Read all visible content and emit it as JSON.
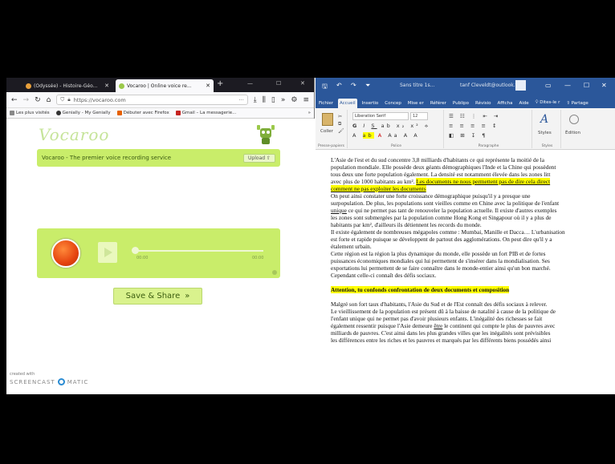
{
  "firefox": {
    "tabs": [
      {
        "title": "(Odyssée) - Histoire-Géo..."
      },
      {
        "title": "Vocaroo | Online voice re..."
      }
    ],
    "url": "https://vocaroo.com",
    "bookmarks": [
      "Les plus visités",
      "Genially - My Genially",
      "Débuter avec Firefox",
      "Gmail – La messagerie..."
    ]
  },
  "vocaroo": {
    "logo": "Vocaroo",
    "tagline": "Vocaroo - The premier voice recording service",
    "upload_label": "Upload ⇧",
    "time_start": "00:00",
    "time_end": "00:00",
    "save_share_label": "Save & Share",
    "save_share_arrow": "»"
  },
  "screencast": {
    "small": "created with",
    "brand": "SCREENCAST",
    "brand_suffix": "MATIC"
  },
  "word": {
    "filename": "Sans titre 1s...",
    "user": "tanf Cleveldt@outlook.fr",
    "menu": [
      "Fichier",
      "Accueil",
      "Insertio",
      "Concep",
      "Mise er",
      "Référer",
      "Publipo",
      "Révisio",
      "Afficha",
      "Aide",
      "Dites-le r",
      "Partage"
    ],
    "ribbon": {
      "paste": "Coller",
      "font_name": "Liberation Serif",
      "font_size": "12",
      "styles": "Styles",
      "edit": "Édition",
      "groups": [
        "Presse-papiers",
        "Police",
        "Paragraphe",
        "Styles"
      ]
    },
    "doc": {
      "l1": "L'Asie de l'est et du sud concentre 3,8 milliards d'habitants ce qui représente la moitié de la",
      "l2": "population mondiale. Elle possède deux géants démographiques l'Inde et la Chine qui possèdent",
      "l3": "tous deux une forte population également. La densité est notamment élevée dans les zones litt",
      "l4a": "avec plus de 1000 habitants au km². ",
      "l4b": "Les documents ne nous permettent pas de dire cela direct",
      "l5": "comment ne pas exploiter les documents",
      "l6": "On peut ainsi constater une forte croissance démographique puisqu'il y a presque une",
      "l7": "surpopulation. De plus, les populations sont vieilles comme en Chine avec la politique de l'enfant",
      "l8a": "unique",
      "l8b": " ce qui ne permet pas tant de renouveler la population actuelle. Il existe d'autres exemples",
      "l9": "les zones sont submergées par la population comme Hong Kong et Singapour où il y a plus de",
      "l10": "habitants par km², d'ailleurs ils détiennent les records du monde.",
      "l11": "Il existe également de nombreuses mégapoles comme : Mumbai, Manille et Dacca… L'urbanisation",
      "l12": "est forte et rapide puisque se développent de partout des agglomérations. On peut dire qu'il y a",
      "l13": "étalement urbain.",
      "l14": "Cette région est la région la plus dynamique du monde, elle possède un fort PIB et de fortes",
      "l15": "puissances économiques mondiales qui lui permettent de s'insérer dans la mondialisation. Ses",
      "l16": "exportations lui permettent de se faire connaître dans le monde-entier ainsi qu'un bon marché.",
      "l17": "Cependant celle-ci connaît des défis sociaux.",
      "heading": "Attention, tu confonds confrontation de deux documents et composition",
      "l18": "Malgré son fort taux d'habitants, l'Asie du Sud et de l'Est connaît des défis sociaux à relever.",
      "l19": "Le vieillissement de la population est présent dû à la baisse de natalité à cause de la politique de",
      "l20": "l'enfant unique qui ne permet pas d'avoir plusieurs enfants. L'inégalité des richesses se fait",
      "l21a": "également ressentir puisque l'Asie demeure ",
      "l21b": "être",
      "l21c": " le continent qui compte le plus de pauvres avec",
      "l22": "milliards de pauvres. C'est ainsi dans les plus grandes villes que les inégalités sont prévisibles",
      "l23": "les différences entre les riches et les pauvres et marqués par les différents biens possédés ainsi"
    }
  }
}
